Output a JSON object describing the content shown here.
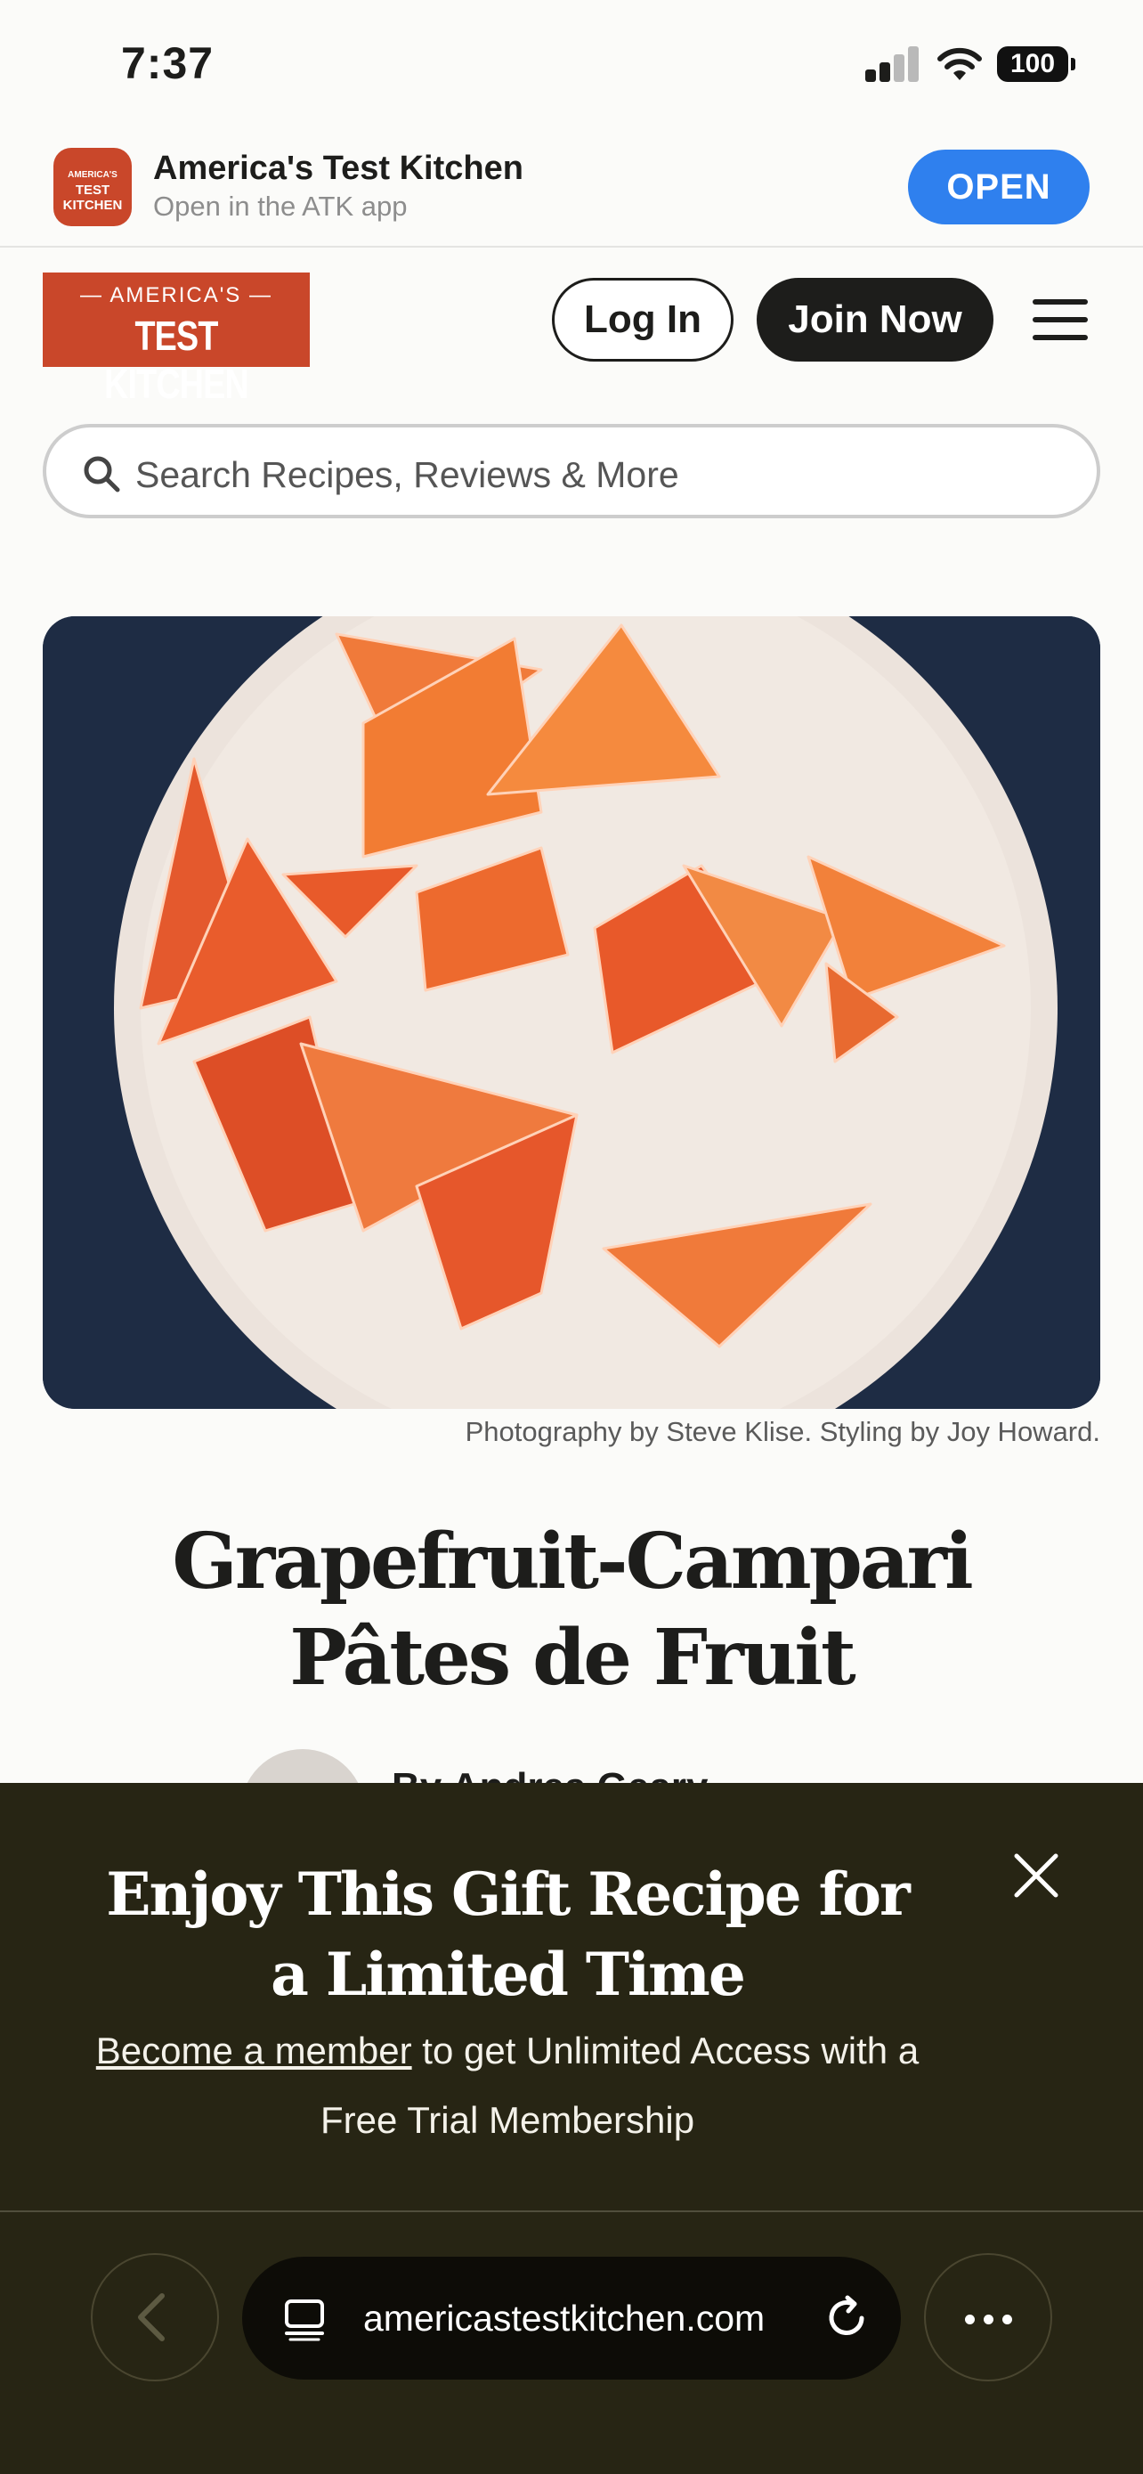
{
  "status_bar": {
    "time": "7:37",
    "battery": "100"
  },
  "app_banner": {
    "icon_text": [
      "AMERICA'S",
      "TEST",
      "KITCHEN"
    ],
    "title": "America's Test Kitchen",
    "subtitle": "Open in the ATK app",
    "open_label": "OPEN"
  },
  "header": {
    "logo_top": "AMERICA'S",
    "logo_main": "TEST KITCHEN",
    "login_label": "Log In",
    "join_label": "Join Now"
  },
  "search": {
    "placeholder": "Search Recipes, Reviews & More"
  },
  "hero": {
    "caption": "Photography by Steve Klise. Styling by Joy Howard."
  },
  "recipe": {
    "title": "Grapefruit-Campari Pâtes de Fruit",
    "author_peek": "By Andrea Geary"
  },
  "gift_overlay": {
    "title": "Enjoy This Gift Recipe for a Limited Time",
    "link_text": "Become a member",
    "text_rest": " to get Unlimited Access with a Free Trial Membership"
  },
  "browser": {
    "url": "americastestkitchen.com"
  },
  "colors": {
    "brand": "#c9472a",
    "dark": "#1d1d1b",
    "overlay": "#272514",
    "open_button": "#2f80ee"
  },
  "icons": [
    "signal-icon",
    "wifi-icon",
    "battery-icon",
    "menu-icon",
    "search-icon",
    "close-icon",
    "back-icon",
    "tabs-icon",
    "reload-icon",
    "more-icon"
  ]
}
